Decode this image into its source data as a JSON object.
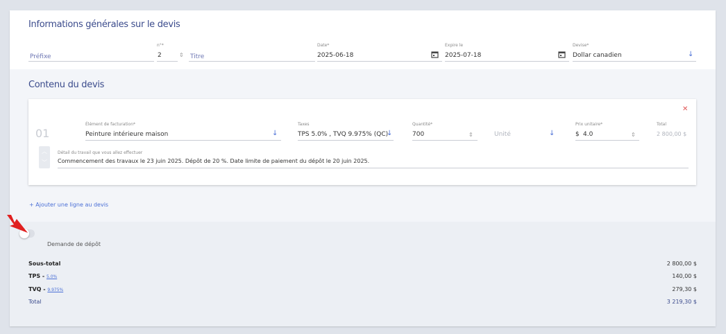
{
  "header": {
    "title": "Informations générales sur le devis",
    "prefix_placeholder": "Préfixe",
    "number_label": "n°*",
    "number_value": "2",
    "title_placeholder": "Titre",
    "date_label": "Date*",
    "date_value": "2025-06-18",
    "expire_label": "Expire le",
    "expire_value": "2025-07-18",
    "currency_label": "Devise*",
    "currency_value": "Dollar canadien"
  },
  "content": {
    "title": "Contenu du devis",
    "line": {
      "index": "01",
      "item_label": "Élément de facturation*",
      "item_value": "Peinture intérieure maison",
      "taxes_label": "Taxes",
      "taxes_value": "TPS 5.0% , TVQ 9.975% (QC)",
      "qty_label": "Quantité*",
      "qty_value": "700",
      "unit_placeholder": "Unité",
      "price_label": "Prix unitaire*",
      "price_currency": "$",
      "price_value": "4.0",
      "total_label": "Total",
      "total_value": "2 800,00 $",
      "detail_label": "Détail du travail que vous allez effectuer",
      "detail_value": "Commencement des travaux le 23 juin 2025. Dépôt de 20 %. Date limite de paiement du dépôt le 20 juin 2025."
    },
    "add_line": "+ Ajouter une ligne au devis"
  },
  "summary": {
    "deposit_label": "Demande de dépôt",
    "deposit_on": false,
    "subtotal_label": "Sous-total",
    "subtotal_value": "2 800,00 $",
    "tps_label": "TPS - ",
    "tps_rate": "5.0%",
    "tps_value": "140,00 $",
    "tvq_label": "TVQ - ",
    "tvq_rate": "9.975%",
    "tvq_value": "279,30 $",
    "total_label": "Total",
    "total_value": "3 219,30 $"
  },
  "colors": {
    "accent": "#3b4b8c",
    "link": "#4a6fd6",
    "annotation_arrow": "#e02020"
  }
}
